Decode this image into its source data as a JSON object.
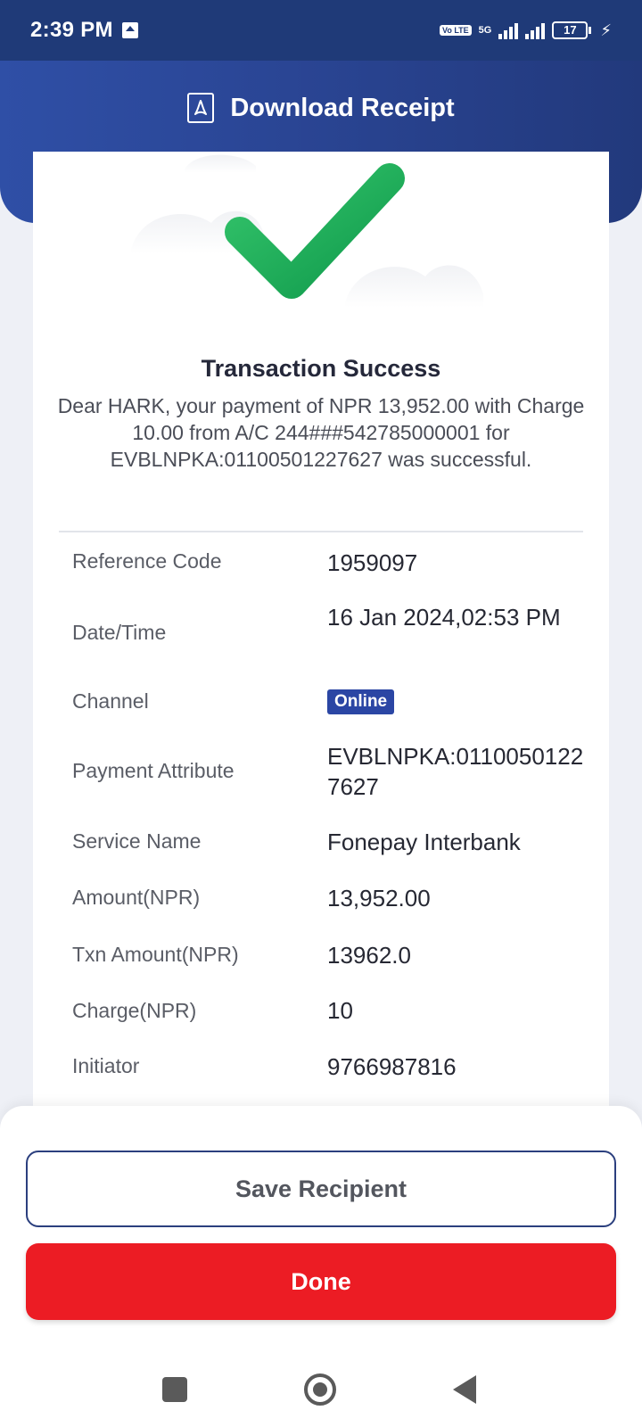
{
  "status_bar": {
    "time": "2:39 PM",
    "volte": "Vo LTE",
    "network": "5G",
    "battery": "17"
  },
  "header": {
    "title": "Download Receipt",
    "icon": "pdf-icon"
  },
  "result": {
    "title": "Transaction Success",
    "message": "Dear HARK, your payment of NPR 13,952.00 with Charge 10.00 from A/C 244###542785000001 for EVBLNPKA:01100501227627 was successful."
  },
  "details": [
    {
      "label": "Reference Code",
      "value": "1959097"
    },
    {
      "label": "Date/Time",
      "value": "16 Jan 2024,02:53 PM"
    },
    {
      "label": "Channel",
      "value": "Online"
    },
    {
      "label": "Payment Attribute",
      "value": "EVBLNPKA:01100501227627"
    },
    {
      "label": "Service Name",
      "value": "Fonepay Interbank"
    },
    {
      "label": "Amount(NPR)",
      "value": "13,952.00"
    },
    {
      "label": "Txn Amount(NPR)",
      "value": "13962.0"
    },
    {
      "label": "Charge(NPR)",
      "value": "10"
    },
    {
      "label": "Initiator",
      "value": "9766987816"
    }
  ],
  "actions": {
    "save_recipient": "Save Recipient",
    "done": "Done"
  },
  "colors": {
    "header": "#2a4594",
    "badge": "#2b46a4",
    "primary_button": "#ec1c24",
    "success_check": "#1fae5b"
  }
}
